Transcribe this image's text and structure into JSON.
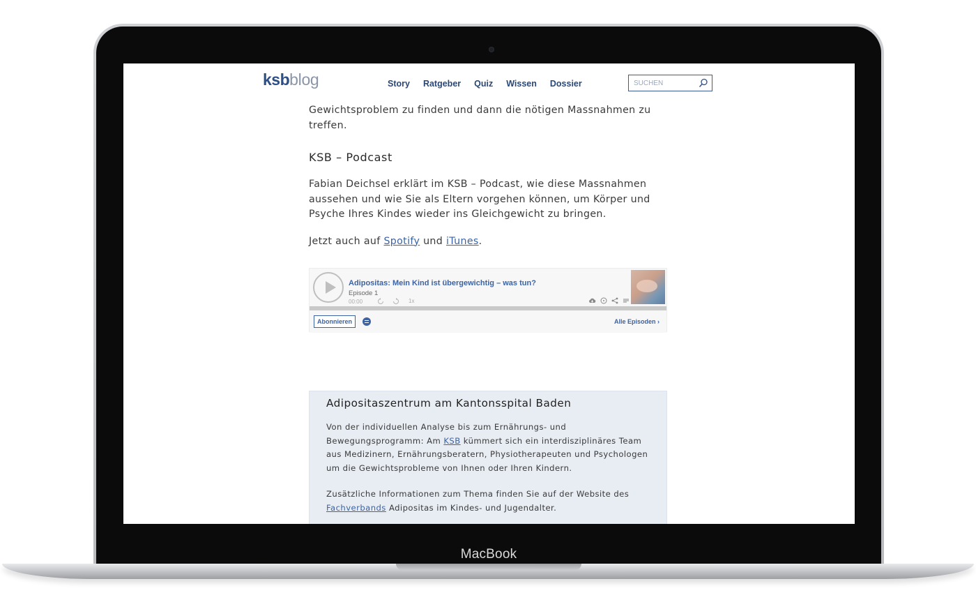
{
  "device": {
    "label": "MacBook"
  },
  "header": {
    "logo_ksb": "ksb",
    "logo_blog": "blog",
    "nav": [
      "Story",
      "Ratgeber",
      "Quiz",
      "Wissen",
      "Dossier"
    ],
    "search_placeholder": "SUCHEN"
  },
  "article": {
    "intro_text": "Gewichtsproblem zu finden und dann die nötigen Massnahmen zu treffen.",
    "podcast_heading": "KSB – Podcast",
    "podcast_text": "Fabian Deichsel erklärt im KSB – Podcast, wie diese Massnahmen aussehen und wie Sie als Eltern vorgehen können, um Körper und Psyche Ihres Kindes wieder ins Gleichgewicht zu bringen.",
    "listen_prefix": "Jetzt auch auf ",
    "spotify_link": "Spotify",
    "listen_and": " und ",
    "itunes_link": "iTunes",
    "listen_suffix": "."
  },
  "player": {
    "episode_title": "Adipositas: Mein Kind ist übergewichtig – was tun?",
    "episode_number": "Episode 1",
    "time": "00:00",
    "speed": "1x",
    "subscribe_label": "Abonnieren",
    "all_episodes_label": "Alle Episoden ›"
  },
  "infobox": {
    "title": "Adipositaszentrum am Kantonsspital Baden",
    "p1_before": "Von der individuellen Analyse bis zum Ernährungs- und Bewegungsprogramm: Am ",
    "p1_link": "KSB",
    "p1_after": " kümmert sich ein interdisziplinäres Team aus Medizinern, Ernährungsberatern, Physiotherapeuten und Psychologen um die Gewichtsprobleme von Ihnen oder Ihren Kindern.",
    "p2_before": "Zusätzliche Informationen zum Thema finden Sie auf der Website des ",
    "p2_link": "Fachverbands",
    "p2_after": " Adipositas im Kindes- und Jugendalter."
  },
  "colors": {
    "brand_blue": "#2e4f86",
    "link_blue": "#3d63a3",
    "infobox_bg": "#e8edf4"
  }
}
